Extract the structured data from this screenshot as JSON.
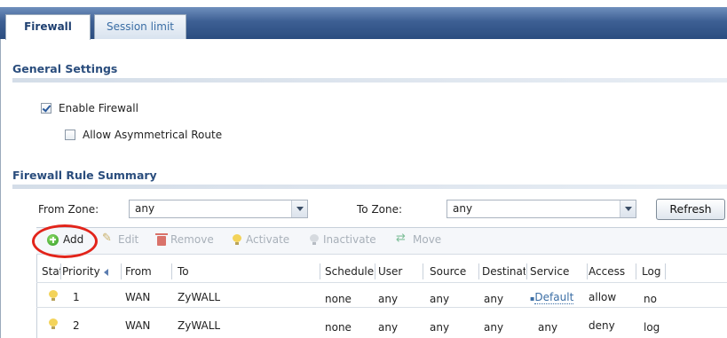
{
  "tabs": [
    {
      "label": "Firewall",
      "active": true
    },
    {
      "label": "Session limit",
      "active": false
    }
  ],
  "general_settings": {
    "title": "General Settings",
    "enable_firewall": {
      "label": "Enable Firewall",
      "checked": true
    },
    "allow_asymmetrical_route": {
      "label": "Allow Asymmetrical Route",
      "checked": false
    }
  },
  "rule_summary": {
    "title": "Firewall Rule Summary",
    "from_zone_label": "From Zone:",
    "from_zone_value": "any",
    "to_zone_label": "To Zone:",
    "to_zone_value": "any",
    "refresh_label": "Refresh"
  },
  "toolbar": {
    "add": "Add",
    "edit": "Edit",
    "remove": "Remove",
    "activate": "Activate",
    "inactivate": "Inactivate",
    "move": "Move"
  },
  "table": {
    "columns": [
      "Stat",
      "Priority",
      "From",
      "To",
      "Schedule",
      "User",
      "Source",
      "Destinati",
      "Service",
      "Access",
      "Log"
    ],
    "rows": [
      {
        "status_icon": "lightbulb-on-icon",
        "priority": "1",
        "from": "WAN",
        "to": "ZyWALL",
        "schedule": "none",
        "user": "any",
        "source": "any",
        "destination": "any",
        "service": "Default",
        "access": "allow",
        "log": "no"
      },
      {
        "status_icon": "lightbulb-on-icon",
        "priority": "2",
        "from": "WAN",
        "to": "ZyWALL",
        "schedule": "none",
        "user": "any",
        "source": "any",
        "destination": "any",
        "service": "any",
        "access": "deny",
        "log": "log"
      }
    ]
  },
  "colors": {
    "tab_bar": "#3d5f93",
    "section_title": "#2a4d7d",
    "highlight_ring": "#e2241a"
  }
}
